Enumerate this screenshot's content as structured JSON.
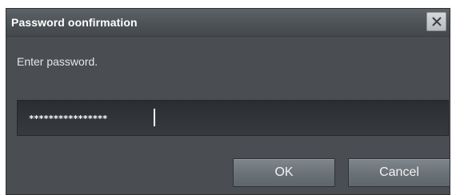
{
  "dialog": {
    "title": "Password oonfirmation",
    "close_icon": "close-icon",
    "prompt": "Enter password.",
    "password_value": "****************",
    "ok_label": "OK",
    "cancel_label": "Cancel"
  }
}
